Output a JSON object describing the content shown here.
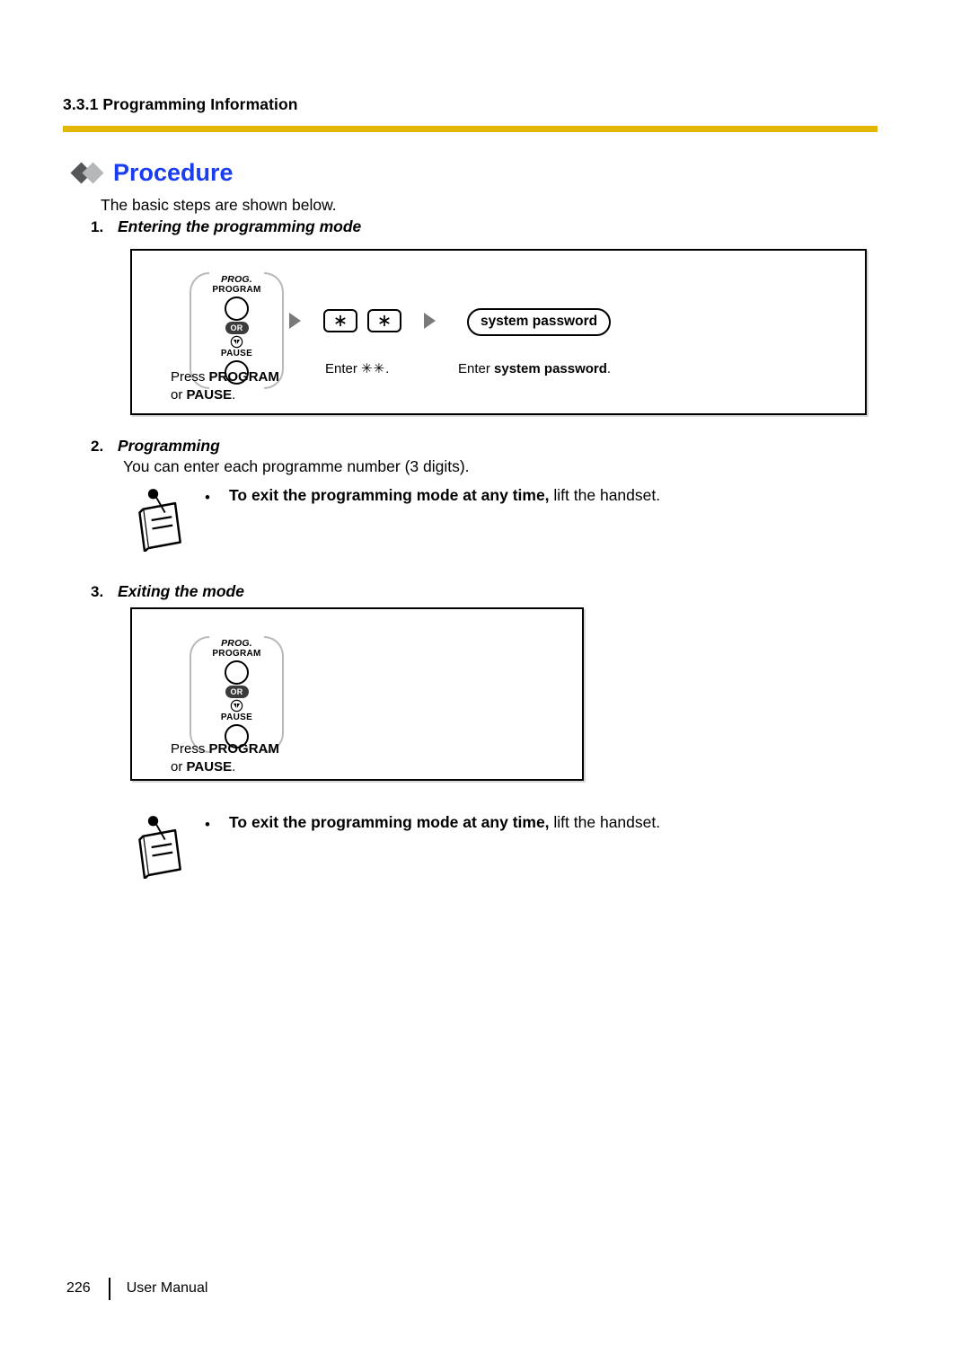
{
  "header": {
    "section_number_title": "3.3.1 Programming Information",
    "rule_color": "#e3b505"
  },
  "procedure_heading": {
    "text": "Procedure",
    "color": "#1a3df0",
    "diamond_dark": "#55565a",
    "diamond_light": "#b6b7b9"
  },
  "intro": {
    "text": "The basic steps are shown below."
  },
  "steps": [
    {
      "number": "1.",
      "title": "Entering the programming mode"
    },
    {
      "number": "2.",
      "title": "Programming"
    },
    {
      "number": "3.",
      "title": "Exiting the mode"
    }
  ],
  "step2_body": "You can enter each programme number (3 digits).",
  "diagram1": {
    "key_cluster": {
      "prog_italic": "PROG.",
      "program_label": "PROGRAM",
      "or_label": "OR",
      "pause_label": "PAUSE"
    },
    "star_keys": [
      "asterisk",
      "asterisk"
    ],
    "password_pill": "system password",
    "captions": [
      {
        "line1_plain": "Press ",
        "line1_bold": "PROGRAM",
        "line2_plain": "or ",
        "line2_bold": "PAUSE",
        "line2_tail": "."
      },
      {
        "plain": "Enter ",
        "stars": "✳✳",
        "tail": "."
      },
      {
        "plain": "Enter ",
        "bold": "system password",
        "tail": "."
      }
    ]
  },
  "diagram2": {
    "key_cluster": {
      "prog_italic": "PROG.",
      "program_label": "PROGRAM",
      "or_label": "OR",
      "pause_label": "PAUSE"
    },
    "caption": {
      "line1_plain": "Press ",
      "line1_bold": "PROGRAM",
      "line2_plain": "or ",
      "line2_bold": "PAUSE",
      "line2_tail": "."
    }
  },
  "notes": [
    {
      "bullet": "•",
      "bold": "To exit the programming mode at any time,",
      "plain": " lift the handset."
    },
    {
      "bullet": "•",
      "bold": "To exit the programming mode at any time,",
      "plain": " lift the handset."
    }
  ],
  "footer": {
    "page_number": "226",
    "label": "User Manual"
  }
}
